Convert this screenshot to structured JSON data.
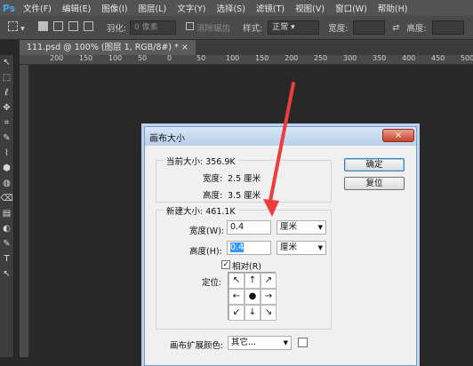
{
  "app": {
    "logo": "Ps",
    "menu": [
      "文件(F)",
      "编辑(E)",
      "图像(I)",
      "图层(L)",
      "文字(Y)",
      "选择(S)",
      "滤镜(T)",
      "视图(V)",
      "窗口(W)",
      "帮助(H)"
    ]
  },
  "options": {
    "feather_label": "羽化:",
    "feather_value": "0 像素",
    "antialias_label": "消除锯齿",
    "style_label": "样式:",
    "style_value": "正常",
    "width_label": "宽度:",
    "height_label": "高度:"
  },
  "doc_tab": "111.psd @ 100% (图层 1, RGB/8#) * ×",
  "ruler_ticks": [
    "200",
    "150",
    "100",
    "50",
    "0",
    "50",
    "100",
    "150",
    "200",
    "250",
    "300",
    "350",
    "400",
    "450",
    "500"
  ],
  "tools": [
    "↖",
    "⬚",
    "ℓ",
    "✥",
    "⌗",
    "✎",
    "⌇",
    "⬢",
    "◍",
    "⌫",
    "▤",
    "◐",
    "✎",
    "T",
    "↖"
  ],
  "dialog": {
    "title": "画布大小",
    "current_legend": "当前大小: 356.9K",
    "current_width_label": "宽度:",
    "current_width_value": "2.5 厘米",
    "current_height_label": "高度:",
    "current_height_value": "3.5 厘米",
    "new_legend": "新建大小: 461.1K",
    "width_label": "宽度(W):",
    "width_value": "0.4",
    "width_unit": "厘米",
    "height_label": "高度(H):",
    "height_value": "0.4",
    "height_unit": "厘米",
    "relative_label": "相对(R)",
    "relative_mark": "✓",
    "anchor_label": "定位:",
    "anchor_cells": [
      "↖",
      "↑",
      "↗",
      "←",
      "●",
      "→",
      "↙",
      "↓",
      "↘"
    ],
    "ok_label": "确定",
    "reset_label": "复位",
    "ext_color_label": "画布扩展颜色:",
    "ext_color_value": "其它...",
    "close_glyph": "×",
    "dropdown_glyph": "▼"
  },
  "annotation_color": "#ee3b3b"
}
